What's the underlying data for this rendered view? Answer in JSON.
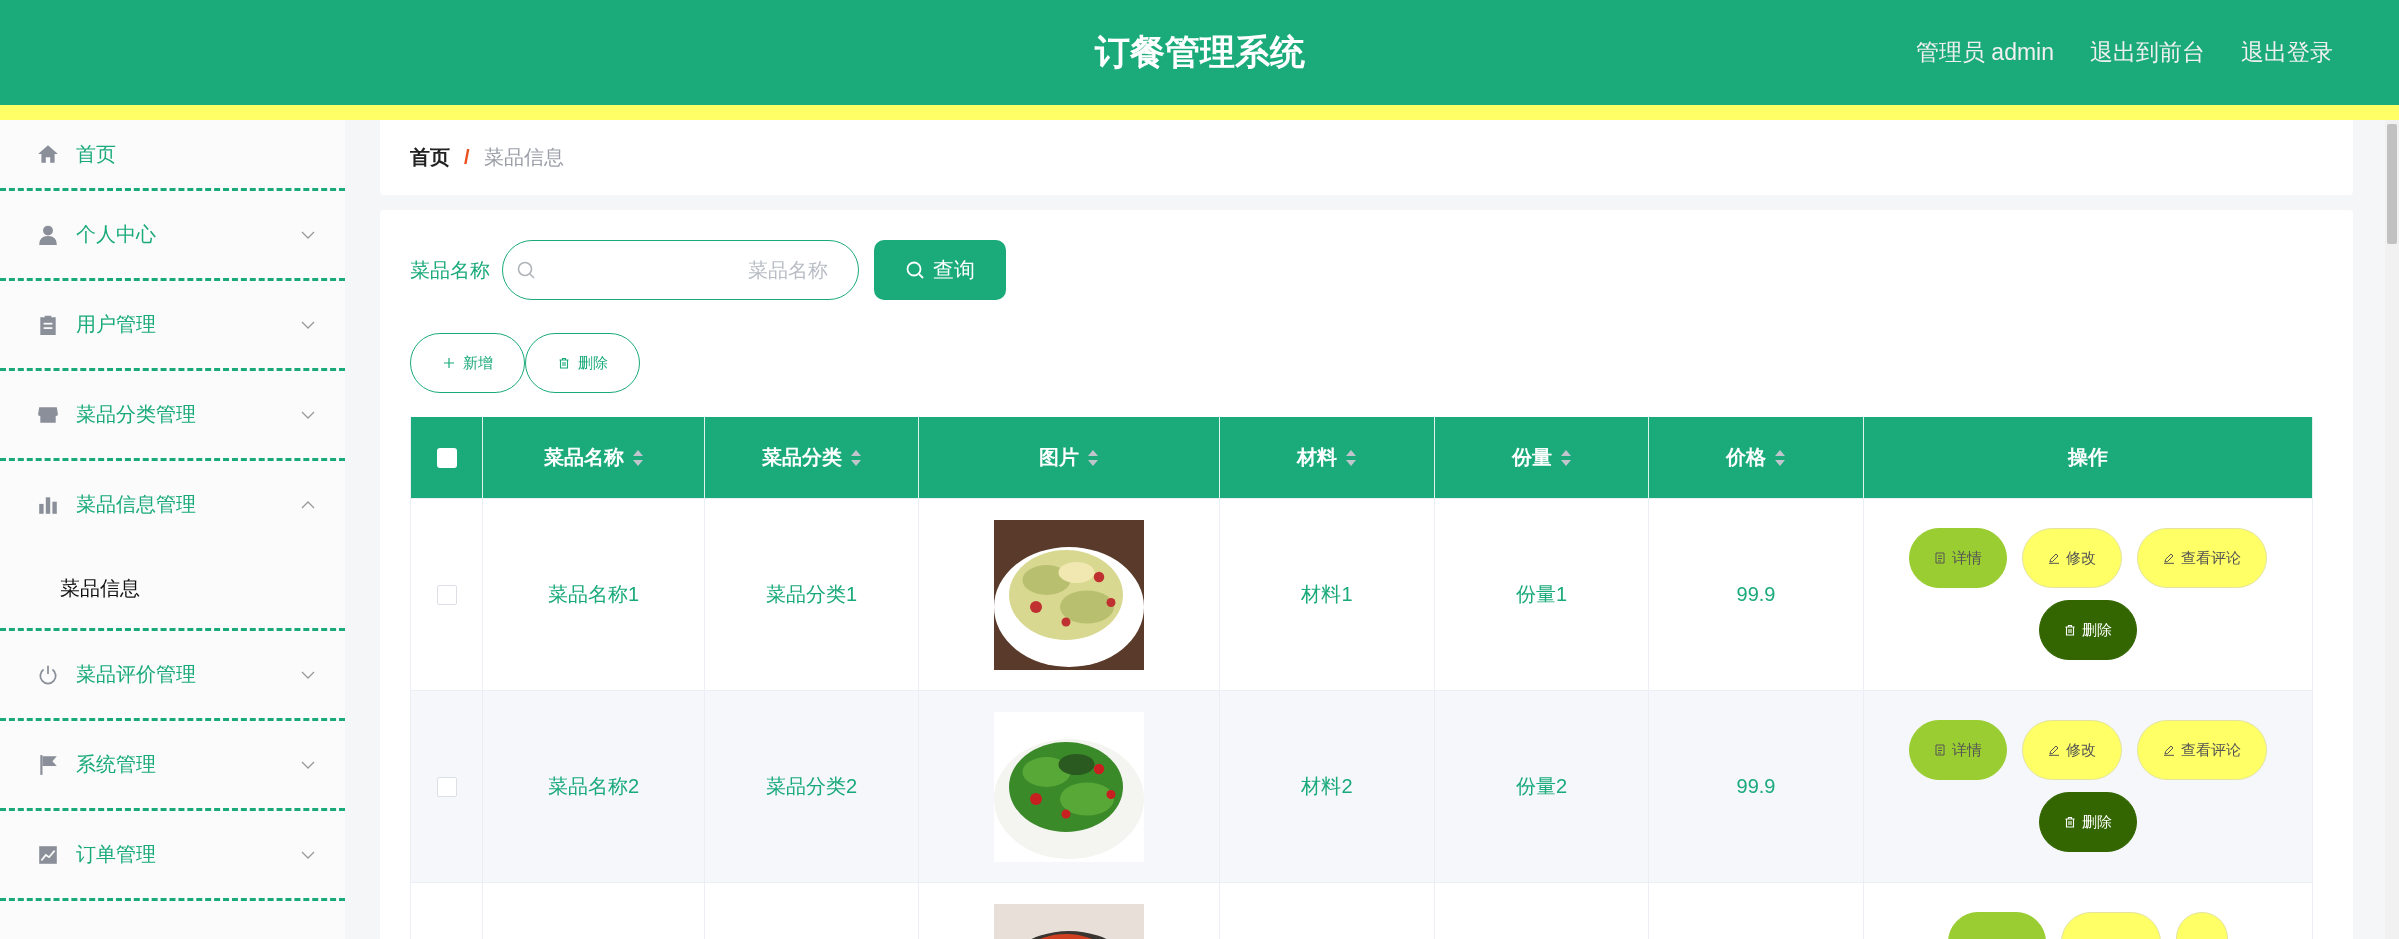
{
  "header": {
    "title": "订餐管理系统",
    "links": [
      "管理员 admin",
      "退出到前台",
      "退出登录"
    ]
  },
  "sidebar": {
    "items": [
      {
        "kind": "link",
        "label": "首页"
      },
      {
        "kind": "group",
        "label": "个人中心",
        "expanded": false
      },
      {
        "kind": "group",
        "label": "用户管理",
        "expanded": false
      },
      {
        "kind": "group",
        "label": "菜品分类管理",
        "expanded": false
      },
      {
        "kind": "group",
        "label": "菜品信息管理",
        "expanded": true,
        "children": [
          {
            "label": "菜品信息",
            "selected": true
          }
        ]
      },
      {
        "kind": "group",
        "label": "菜品评价管理",
        "expanded": false
      },
      {
        "kind": "group",
        "label": "系统管理",
        "expanded": false
      },
      {
        "kind": "group",
        "label": "订单管理",
        "expanded": false
      }
    ]
  },
  "breadcrumb": [
    "首页",
    "/",
    "菜品信息"
  ],
  "search": {
    "label": "菜品名称",
    "placeholder": "菜品名称",
    "button": "查询"
  },
  "toolbar": [
    "新增",
    "删除"
  ],
  "table": {
    "columns": [
      {
        "label": "菜品名称",
        "sortable": true
      },
      {
        "label": "菜品分类",
        "sortable": true
      },
      {
        "label": "图片",
        "sortable": true
      },
      {
        "label": "材料",
        "sortable": true
      },
      {
        "label": "份量",
        "sortable": true
      },
      {
        "label": "价格",
        "sortable": true
      },
      {
        "label": "操作",
        "sortable": false
      }
    ],
    "select_all_checked": false,
    "rows": [
      {
        "kind": "full",
        "checked": false,
        "name": "菜品名称1",
        "category": "菜品分类1",
        "picture": {
          "kind": "picture"
        },
        "material": "材料1",
        "portion": "份量1",
        "price": "99.9",
        "actions": [
          {
            "kind": "detail",
            "label": "详情"
          },
          {
            "kind": "edit",
            "label": "修改"
          },
          {
            "kind": "edit",
            "label": "查看评论"
          },
          {
            "kind": "delete",
            "label": "删除"
          }
        ]
      },
      {
        "kind": "full",
        "checked": false,
        "name": "菜品名称2",
        "category": "菜品分类2",
        "picture": {
          "kind": "picture"
        },
        "material": "材料2",
        "portion": "份量2",
        "price": "99.9",
        "actions": [
          {
            "kind": "detail",
            "label": "详情"
          },
          {
            "kind": "edit",
            "label": "修改"
          },
          {
            "kind": "edit",
            "label": "查看评论"
          },
          {
            "kind": "delete",
            "label": "删除"
          }
        ]
      },
      {
        "kind": "partial",
        "picture": {
          "kind": "picture"
        },
        "actions": [
          {
            "kind": "detail"
          },
          {
            "kind": "edit"
          },
          {
            "kind": "edit"
          }
        ]
      }
    ]
  }
}
